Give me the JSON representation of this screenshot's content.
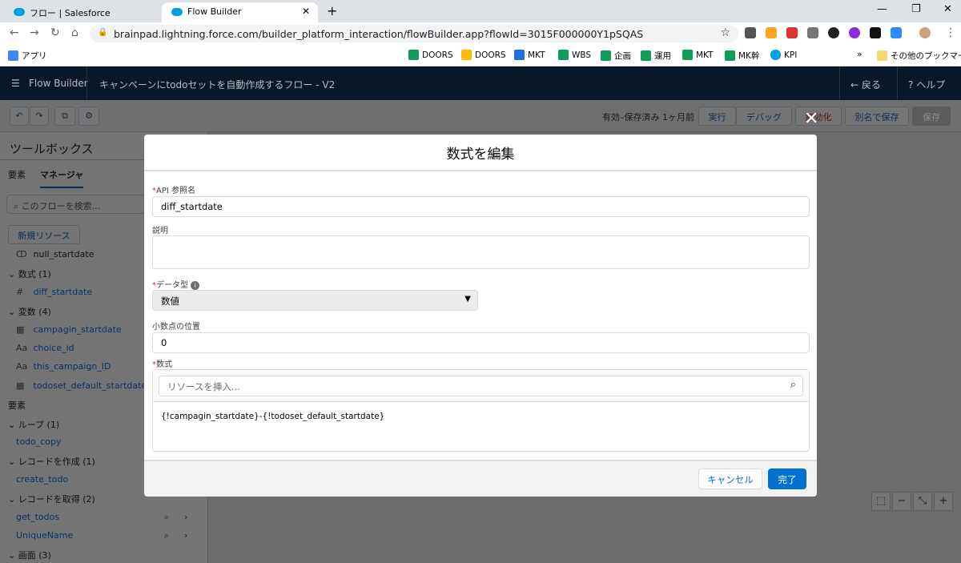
{
  "browser": {
    "tabs": [
      {
        "title": "フロー | Salesforce"
      },
      {
        "title": "Flow Builder"
      }
    ],
    "url": "brainpad.lightning.force.com/builder_platform_interaction/flowBuilder.app?flowId=3015F000000Y1pSQAS",
    "bookmarks": [
      "アプリ",
      "DOORS",
      "DOORS",
      "MKT",
      "WBS",
      "企画",
      "運用",
      "MKT",
      "MK幹",
      "KPI",
      "»",
      "その他のブックマーク"
    ]
  },
  "header": {
    "app": "Flow Builder",
    "flow_title": "キャンペーンにtodoセットを自動作成するフロー - V2",
    "back": "戻る",
    "help": "ヘルプ"
  },
  "toolbar": {
    "status": "有効–保存済み 1ヶ月前",
    "run": "実行",
    "debug": "デバッグ",
    "deactivate": "無効化",
    "save_as": "別名で保存",
    "save": "保存"
  },
  "toolbox": {
    "title": "ツールボックス",
    "tab_elements": "要素",
    "tab_manager": "マネージャ",
    "search_placeholder": "このフローを検索...",
    "new_resource": "新規リソース",
    "items": [
      {
        "type": "item",
        "icon": "choice-icon",
        "label": "null_startdate"
      },
      {
        "type": "section",
        "label": "数式 (1)"
      },
      {
        "type": "item",
        "icon": "hash-icon",
        "label": "diff_startdate"
      },
      {
        "type": "section",
        "label": "変数 (4)"
      },
      {
        "type": "item",
        "icon": "calendar-icon",
        "label": "campagin_startdate"
      },
      {
        "type": "item",
        "icon": "text-icon",
        "label": "choice_id"
      },
      {
        "type": "item",
        "icon": "text-icon",
        "label": "this_campaign_ID"
      },
      {
        "type": "item",
        "icon": "calendar-icon",
        "label": "todoset_default_startdate"
      },
      {
        "type": "heading",
        "label": "要素"
      },
      {
        "type": "section",
        "label": "ループ (1)"
      },
      {
        "type": "link",
        "label": "todo_copy"
      },
      {
        "type": "section",
        "label": "レコードを作成 (1)"
      },
      {
        "type": "link",
        "label": "create_todo"
      },
      {
        "type": "section",
        "label": "レコードを取得 (2)"
      },
      {
        "type": "link",
        "label": "get_todos"
      },
      {
        "type": "link",
        "label": "UniqueName"
      },
      {
        "type": "section",
        "label": "画面 (3)"
      }
    ]
  },
  "modal": {
    "title": "数式を編集",
    "api_label": "API 参照名",
    "api_value": "diff_startdate",
    "desc_label": "説明",
    "desc_value": "",
    "type_label": "データ型",
    "type_value": "数値",
    "decimal_label": "小数点の位置",
    "decimal_value": "0",
    "formula_label": "数式",
    "resource_placeholder": "リソースを挿入...",
    "formula_value": "{!campagin_startdate}-{!todoset_default_startdate}",
    "cancel": "キャンセル",
    "done": "完了"
  }
}
